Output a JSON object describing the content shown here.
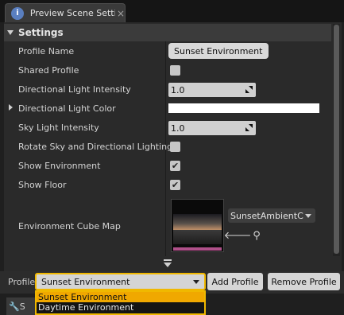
{
  "tab": {
    "title": "Preview Scene Setti",
    "close_glyph": "×",
    "icon": "preview-scene-icon"
  },
  "settings": {
    "header": "Settings",
    "rows": [
      {
        "label": "Profile Name",
        "type": "text",
        "value": "Sunset Environment"
      },
      {
        "label": "Shared Profile",
        "type": "checkbox",
        "checked": false
      },
      {
        "label": "Directional Light Intensity",
        "type": "number",
        "value": "1.0"
      },
      {
        "label": "Directional Light Color",
        "type": "color",
        "value": "#ffffff"
      },
      {
        "label": "Sky Light Intensity",
        "type": "number",
        "value": "1.0"
      },
      {
        "label": "Rotate Sky and Directional Lighting",
        "type": "checkbox",
        "checked": false
      },
      {
        "label": "Show Environment",
        "type": "checkbox",
        "checked": true
      },
      {
        "label": "Show Floor",
        "type": "checkbox",
        "checked": true
      },
      {
        "label": "Environment Cube Map",
        "type": "asset",
        "value": "SunsetAmbientCubemap"
      }
    ],
    "check_glyph": "✔"
  },
  "asset_picker": {
    "selected": "SunsetAmbientCub",
    "use_icon": "arrow-left-icon",
    "browse_icon": "search-icon",
    "use_glyph": "🡐",
    "browse_glyph": "⚲"
  },
  "profile_bar": {
    "label": "Profile",
    "selected": "Sunset Environment",
    "options": [
      "Sunset Environment",
      "Daytime Environment"
    ],
    "add_button": "Add Profile",
    "remove_button": "Remove Profile"
  },
  "footer_tab": {
    "label": "S"
  },
  "colors": {
    "accent": "#f0b800",
    "panel": "#2a2a2a",
    "header": "#3b3b3b"
  }
}
